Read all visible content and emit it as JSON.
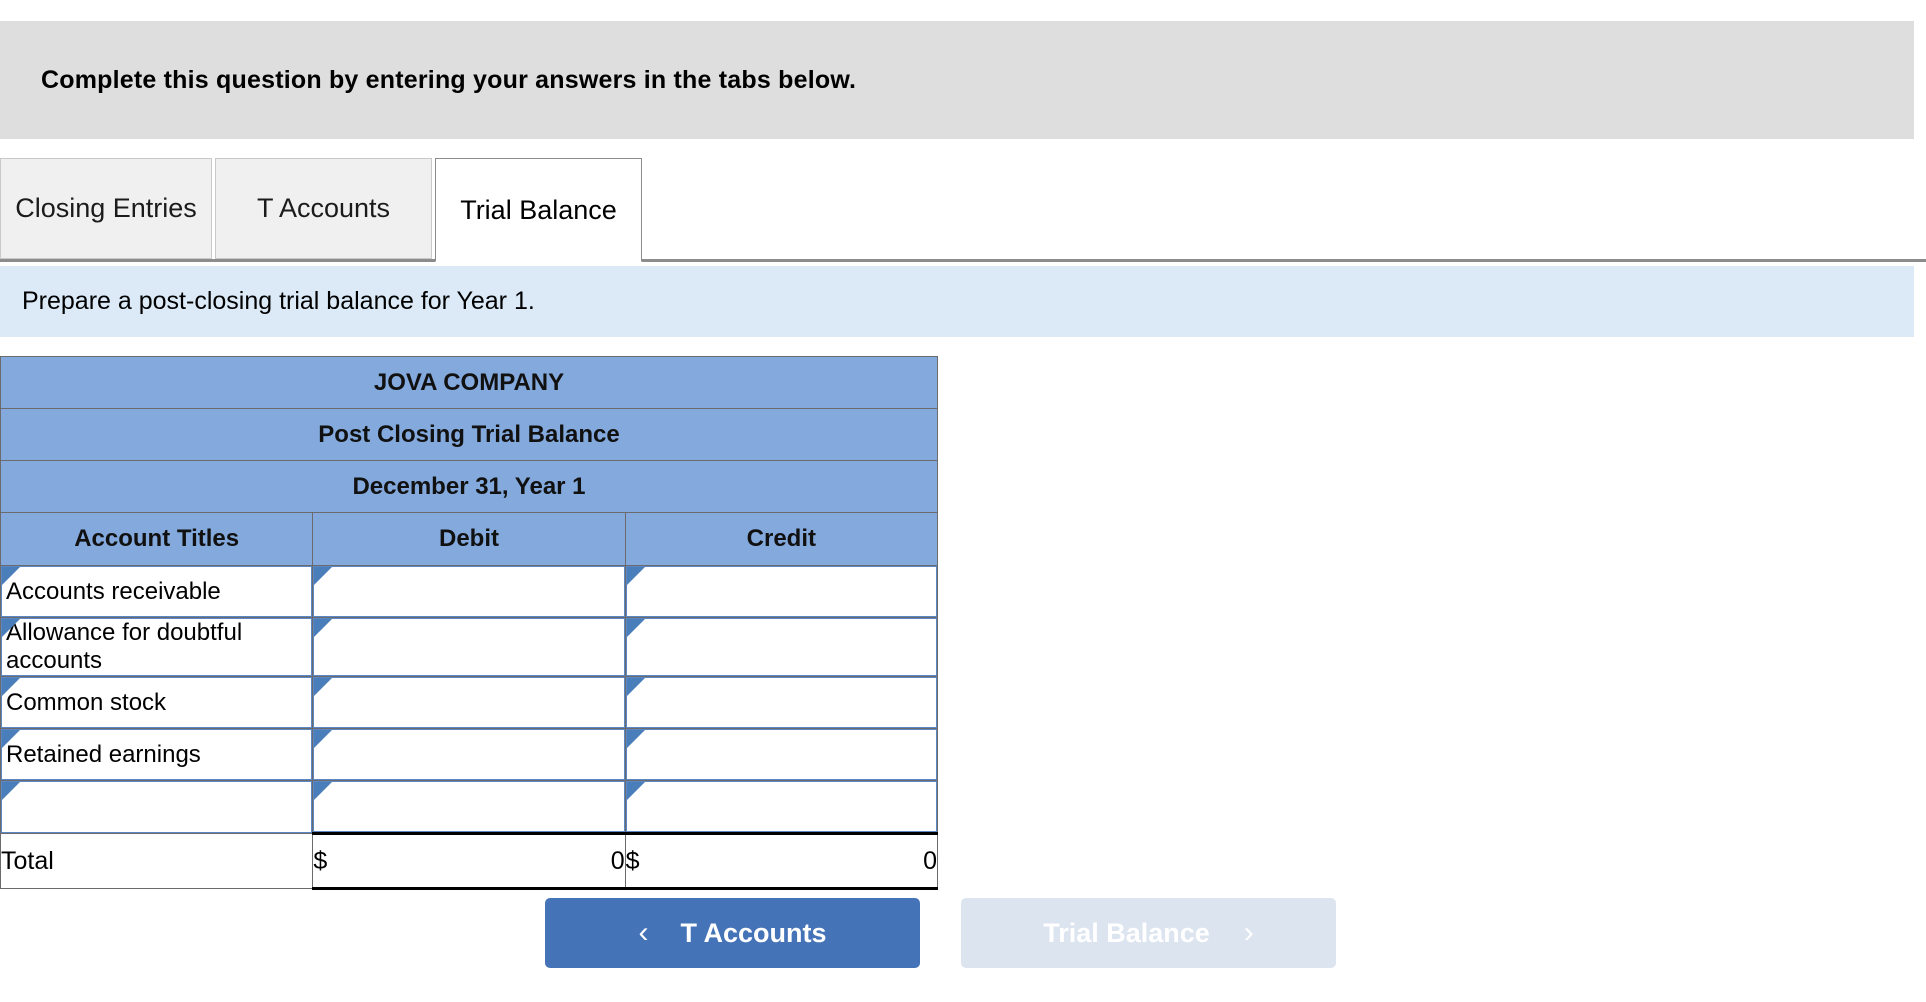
{
  "banner": {
    "text": "Complete this question by entering your answers in the tabs below."
  },
  "tabs": [
    {
      "label": "Closing Entries",
      "active": false
    },
    {
      "label": "T Accounts",
      "active": false
    },
    {
      "label": "Trial Balance",
      "active": true
    }
  ],
  "prompt": {
    "text": "Prepare a post-closing trial balance for Year 1."
  },
  "table": {
    "company": "JOVA COMPANY",
    "statement": "Post Closing Trial Balance",
    "date": "December 31, Year 1",
    "columns": {
      "accounts": "Account Titles",
      "debit": "Debit",
      "credit": "Credit"
    },
    "rows": [
      {
        "account": "Accounts receivable",
        "debit": "",
        "credit": ""
      },
      {
        "account": "Allowance for doubtful accounts",
        "debit": "",
        "credit": ""
      },
      {
        "account": "Common stock",
        "debit": "",
        "credit": ""
      },
      {
        "account": "Retained earnings",
        "debit": "",
        "credit": ""
      },
      {
        "account": "",
        "debit": "",
        "credit": ""
      }
    ],
    "total": {
      "label": "Total",
      "debit_currency": "$",
      "debit_value": "0",
      "credit_currency": "$",
      "credit_value": "0"
    }
  },
  "nav": {
    "prev_label": "T Accounts",
    "prev_icon": "chevron-left-icon",
    "prev_glyph": "‹",
    "next_label": "Trial Balance",
    "next_icon": "chevron-right-icon",
    "next_glyph": "›"
  },
  "colors": {
    "banner_bg": "#dedede",
    "prompt_bg": "#dceaf7",
    "table_header_blue": "#83a9dd",
    "input_border_blue": "#5b87c4",
    "marker_blue": "#4a7ebb",
    "button_active": "#4573b8",
    "button_disabled": "#dce4f0",
    "tab_inactive": "#f0f0f0"
  }
}
